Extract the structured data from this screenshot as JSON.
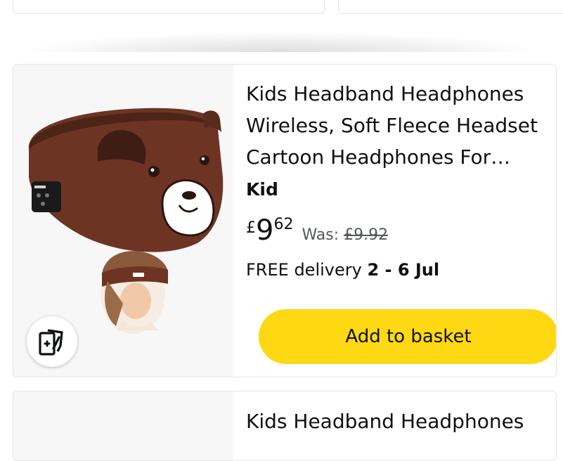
{
  "products": [
    {
      "title": "Kids Headband Headphones Wireless, Soft Fleece Headset Cartoon Headphones For…",
      "brand": "Kid",
      "price": {
        "currency": "£",
        "whole": "9",
        "fraction": "62"
      },
      "was": {
        "label": "Was:",
        "value": "£9.92"
      },
      "delivery": {
        "prefix": "FREE delivery",
        "dates": "2 - 6 Jul"
      },
      "add_to_basket_label": "Add to basket",
      "compare_icon": "add-to-compare-icon"
    },
    {
      "title": "Kids Headband Headphones"
    }
  ],
  "colors": {
    "button_yellow": "#ffd814",
    "image_bg": "#f7f7f7",
    "text": "#0f1111",
    "muted": "#565959"
  }
}
